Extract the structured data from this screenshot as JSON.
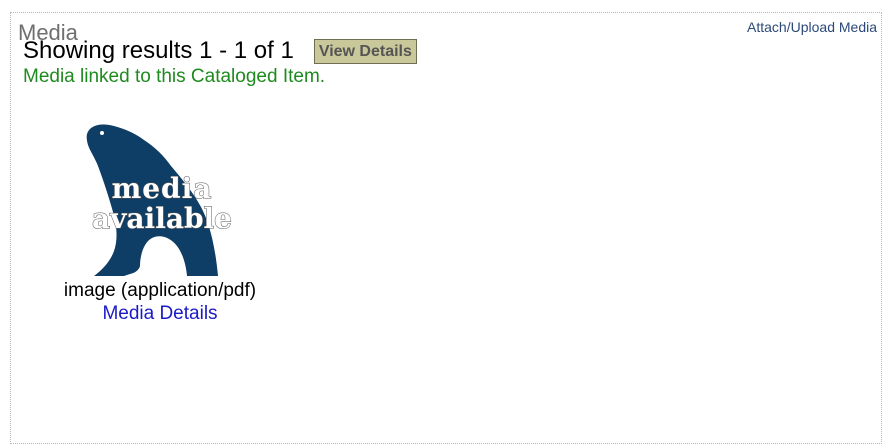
{
  "section": {
    "title": "Media",
    "attach_link": "Attach/Upload Media"
  },
  "results": {
    "summary": "Showing results 1 - 1 of 1",
    "view_details_label": "View Details",
    "linked_message": "Media linked to this Cataloged Item."
  },
  "media_items": [
    {
      "thumbnail_text_line1": "media",
      "thumbnail_text_line2": "available",
      "thumbnail_icon": "bear-silhouette-icon",
      "caption": "image (application/pdf)",
      "details_link": "Media Details"
    }
  ],
  "colors": {
    "title_gray": "#6f6f6f",
    "link_blue": "#1a1ac8",
    "attach_link_blue": "#2b4a7a",
    "success_green": "#1f8a1f",
    "button_bg": "#c8c89a",
    "thumbnail_navy": "#0e3d66"
  }
}
